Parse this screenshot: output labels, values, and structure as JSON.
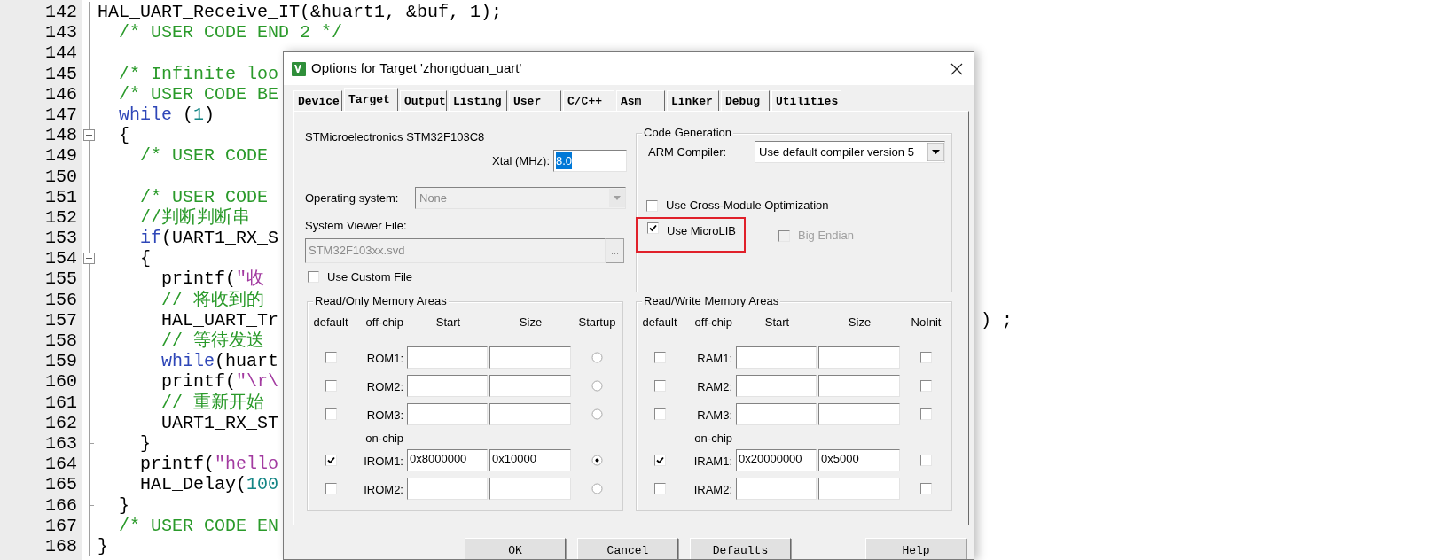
{
  "editor": {
    "lines": [
      {
        "number": "142",
        "segments": [
          {
            "kind": "plain",
            "text": "HAL_UART_Receive_IT(&huart1, &buf, 1);"
          }
        ]
      },
      {
        "number": "143",
        "segments": [
          {
            "kind": "comment",
            "text": "  /* USER CODE END 2 */"
          }
        ]
      },
      {
        "number": "144"
      },
      {
        "number": "145",
        "segments": [
          {
            "kind": "comment",
            "text": "  /* Infinite loo"
          }
        ]
      },
      {
        "number": "146",
        "segments": [
          {
            "kind": "comment",
            "text": "  /* USER CODE BE"
          }
        ]
      },
      {
        "number": "147",
        "segments": [
          {
            "kind": "keyword",
            "text": "  while"
          },
          {
            "kind": "plain",
            "text": " ("
          },
          {
            "kind": "number",
            "text": "1"
          },
          {
            "kind": "plain",
            "text": ")"
          }
        ]
      },
      {
        "number": "148",
        "fold_box": true,
        "segments": [
          {
            "kind": "plain",
            "text": "  {"
          }
        ]
      },
      {
        "number": "149",
        "segments": [
          {
            "kind": "comment",
            "text": "    /* USER CODE"
          }
        ]
      },
      {
        "number": "150"
      },
      {
        "number": "151",
        "segments": [
          {
            "kind": "comment",
            "text": "    /* USER CODE"
          }
        ]
      },
      {
        "number": "152",
        "segments": [
          {
            "kind": "comment",
            "text": "    //判断判断串"
          }
        ]
      },
      {
        "number": "153",
        "segments": [
          {
            "kind": "keyword",
            "text": "    if"
          },
          {
            "kind": "plain",
            "text": "(UART1_RX_S"
          }
        ]
      },
      {
        "number": "154",
        "fold_box": true,
        "segments": [
          {
            "kind": "plain",
            "text": "    {"
          }
        ]
      },
      {
        "number": "155",
        "segments": [
          {
            "kind": "plain",
            "text": "      printf("
          },
          {
            "kind": "string",
            "text": "\"收"
          }
        ]
      },
      {
        "number": "156",
        "segments": [
          {
            "kind": "comment",
            "text": "      // 将收到的"
          }
        ]
      },
      {
        "number": "157",
        "segments": [
          {
            "kind": "plain",
            "text": "      HAL_UART_Tr"
          }
        ],
        "tail": ") ;"
      },
      {
        "number": "158",
        "segments": [
          {
            "kind": "comment",
            "text": "      // 等待发送"
          }
        ]
      },
      {
        "number": "159",
        "segments": [
          {
            "kind": "keyword",
            "text": "      while"
          },
          {
            "kind": "plain",
            "text": "(huart"
          }
        ]
      },
      {
        "number": "160",
        "segments": [
          {
            "kind": "plain",
            "text": "      printf("
          },
          {
            "kind": "string",
            "text": "\"\\r\\"
          }
        ]
      },
      {
        "number": "161",
        "segments": [
          {
            "kind": "comment",
            "text": "      // 重新开始"
          }
        ]
      },
      {
        "number": "162",
        "segments": [
          {
            "kind": "plain",
            "text": "      UART1_RX_ST"
          }
        ]
      },
      {
        "number": "163",
        "fold_end": true,
        "segments": [
          {
            "kind": "plain",
            "text": "    }"
          }
        ]
      },
      {
        "number": "164",
        "segments": [
          {
            "kind": "plain",
            "text": "    printf("
          },
          {
            "kind": "string",
            "text": "\"hello"
          }
        ]
      },
      {
        "number": "165",
        "segments": [
          {
            "kind": "plain",
            "text": "    HAL_Delay("
          },
          {
            "kind": "number",
            "text": "100"
          }
        ]
      },
      {
        "number": "166",
        "fold_end": true,
        "segments": [
          {
            "kind": "plain",
            "text": "  }"
          }
        ]
      },
      {
        "number": "167",
        "segments": [
          {
            "kind": "comment",
            "text": "  /* USER CODE EN"
          }
        ]
      },
      {
        "number": "168",
        "segments": [
          {
            "kind": "plain",
            "text": "}"
          }
        ]
      }
    ]
  },
  "dialog": {
    "title": "Options for Target 'zhongduan_uart'",
    "tabs": [
      {
        "label": "Device",
        "selected": false
      },
      {
        "label": "Target",
        "selected": true
      },
      {
        "label": "Output",
        "selected": false
      },
      {
        "label": "Listing",
        "selected": false
      },
      {
        "label": "User",
        "selected": false
      },
      {
        "label": "C/C++",
        "selected": false
      },
      {
        "label": "Asm",
        "selected": false
      },
      {
        "label": "Linker",
        "selected": false
      },
      {
        "label": "Debug",
        "selected": false
      },
      {
        "label": "Utilities",
        "selected": false
      }
    ],
    "device": "STMicroelectronics STM32F103C8",
    "xtal": {
      "label": "Xtal (MHz):",
      "value": "8.0",
      "highlighted": true
    },
    "operating_system": {
      "label": "Operating system:",
      "value": "None",
      "disabled": true
    },
    "system_viewer_file": {
      "label": "System Viewer File:",
      "value": "STM32F103xx.svd",
      "disabled": true,
      "browse": "..."
    },
    "custom_file": {
      "label": "Use Custom File",
      "checked": false
    },
    "code_generation": {
      "title": "Code Generation",
      "compiler": {
        "label": "ARM Compiler:",
        "value": "Use default compiler version 5"
      },
      "option_rows": [
        [
          {
            "label": "Use Cross-Module Optimization",
            "checked": false,
            "disabled": false,
            "highlighted": false
          }
        ],
        [
          {
            "label": "Use MicroLIB",
            "checked": true,
            "disabled": false,
            "highlighted": true
          },
          {
            "label": "Big Endian",
            "checked": false,
            "disabled": true,
            "highlighted": false
          }
        ]
      ]
    },
    "read_only_memory": {
      "title": "Read/Only Memory Areas",
      "columns": [
        "default",
        "off-chip",
        "Start",
        "Size",
        "Startup"
      ],
      "rows": [
        {
          "kind": "area",
          "label": "ROM1:",
          "default": false,
          "selected": false
        },
        {
          "kind": "area",
          "label": "ROM2:",
          "default": false,
          "selected": false
        },
        {
          "kind": "area",
          "label": "ROM3:",
          "default": false,
          "selected": false
        },
        {
          "kind": "heading",
          "label": "on-chip"
        },
        {
          "kind": "area",
          "label": "IROM1:",
          "default": true,
          "start": "0x8000000",
          "size": "0x10000",
          "selected": true
        },
        {
          "kind": "area",
          "label": "IROM2:",
          "default": false,
          "selected": false
        }
      ]
    },
    "read_write_memory": {
      "title": "Read/Write Memory Areas",
      "columns": [
        "default",
        "off-chip",
        "Start",
        "Size",
        "NoInit"
      ],
      "rows": [
        {
          "kind": "area",
          "label": "RAM1:",
          "default": false,
          "no_init": false
        },
        {
          "kind": "area",
          "label": "RAM2:",
          "default": false,
          "no_init": false
        },
        {
          "kind": "area",
          "label": "RAM3:",
          "default": false,
          "no_init": false
        },
        {
          "kind": "heading",
          "label": "on-chip"
        },
        {
          "kind": "area",
          "label": "IRAM1:",
          "default": true,
          "start": "0x20000000",
          "size": "0x5000",
          "no_init": false
        },
        {
          "kind": "area",
          "label": "IRAM2:",
          "default": false,
          "no_init": false
        }
      ]
    },
    "buttons": [
      "OK",
      "Cancel",
      "Defaults",
      "Help"
    ]
  }
}
